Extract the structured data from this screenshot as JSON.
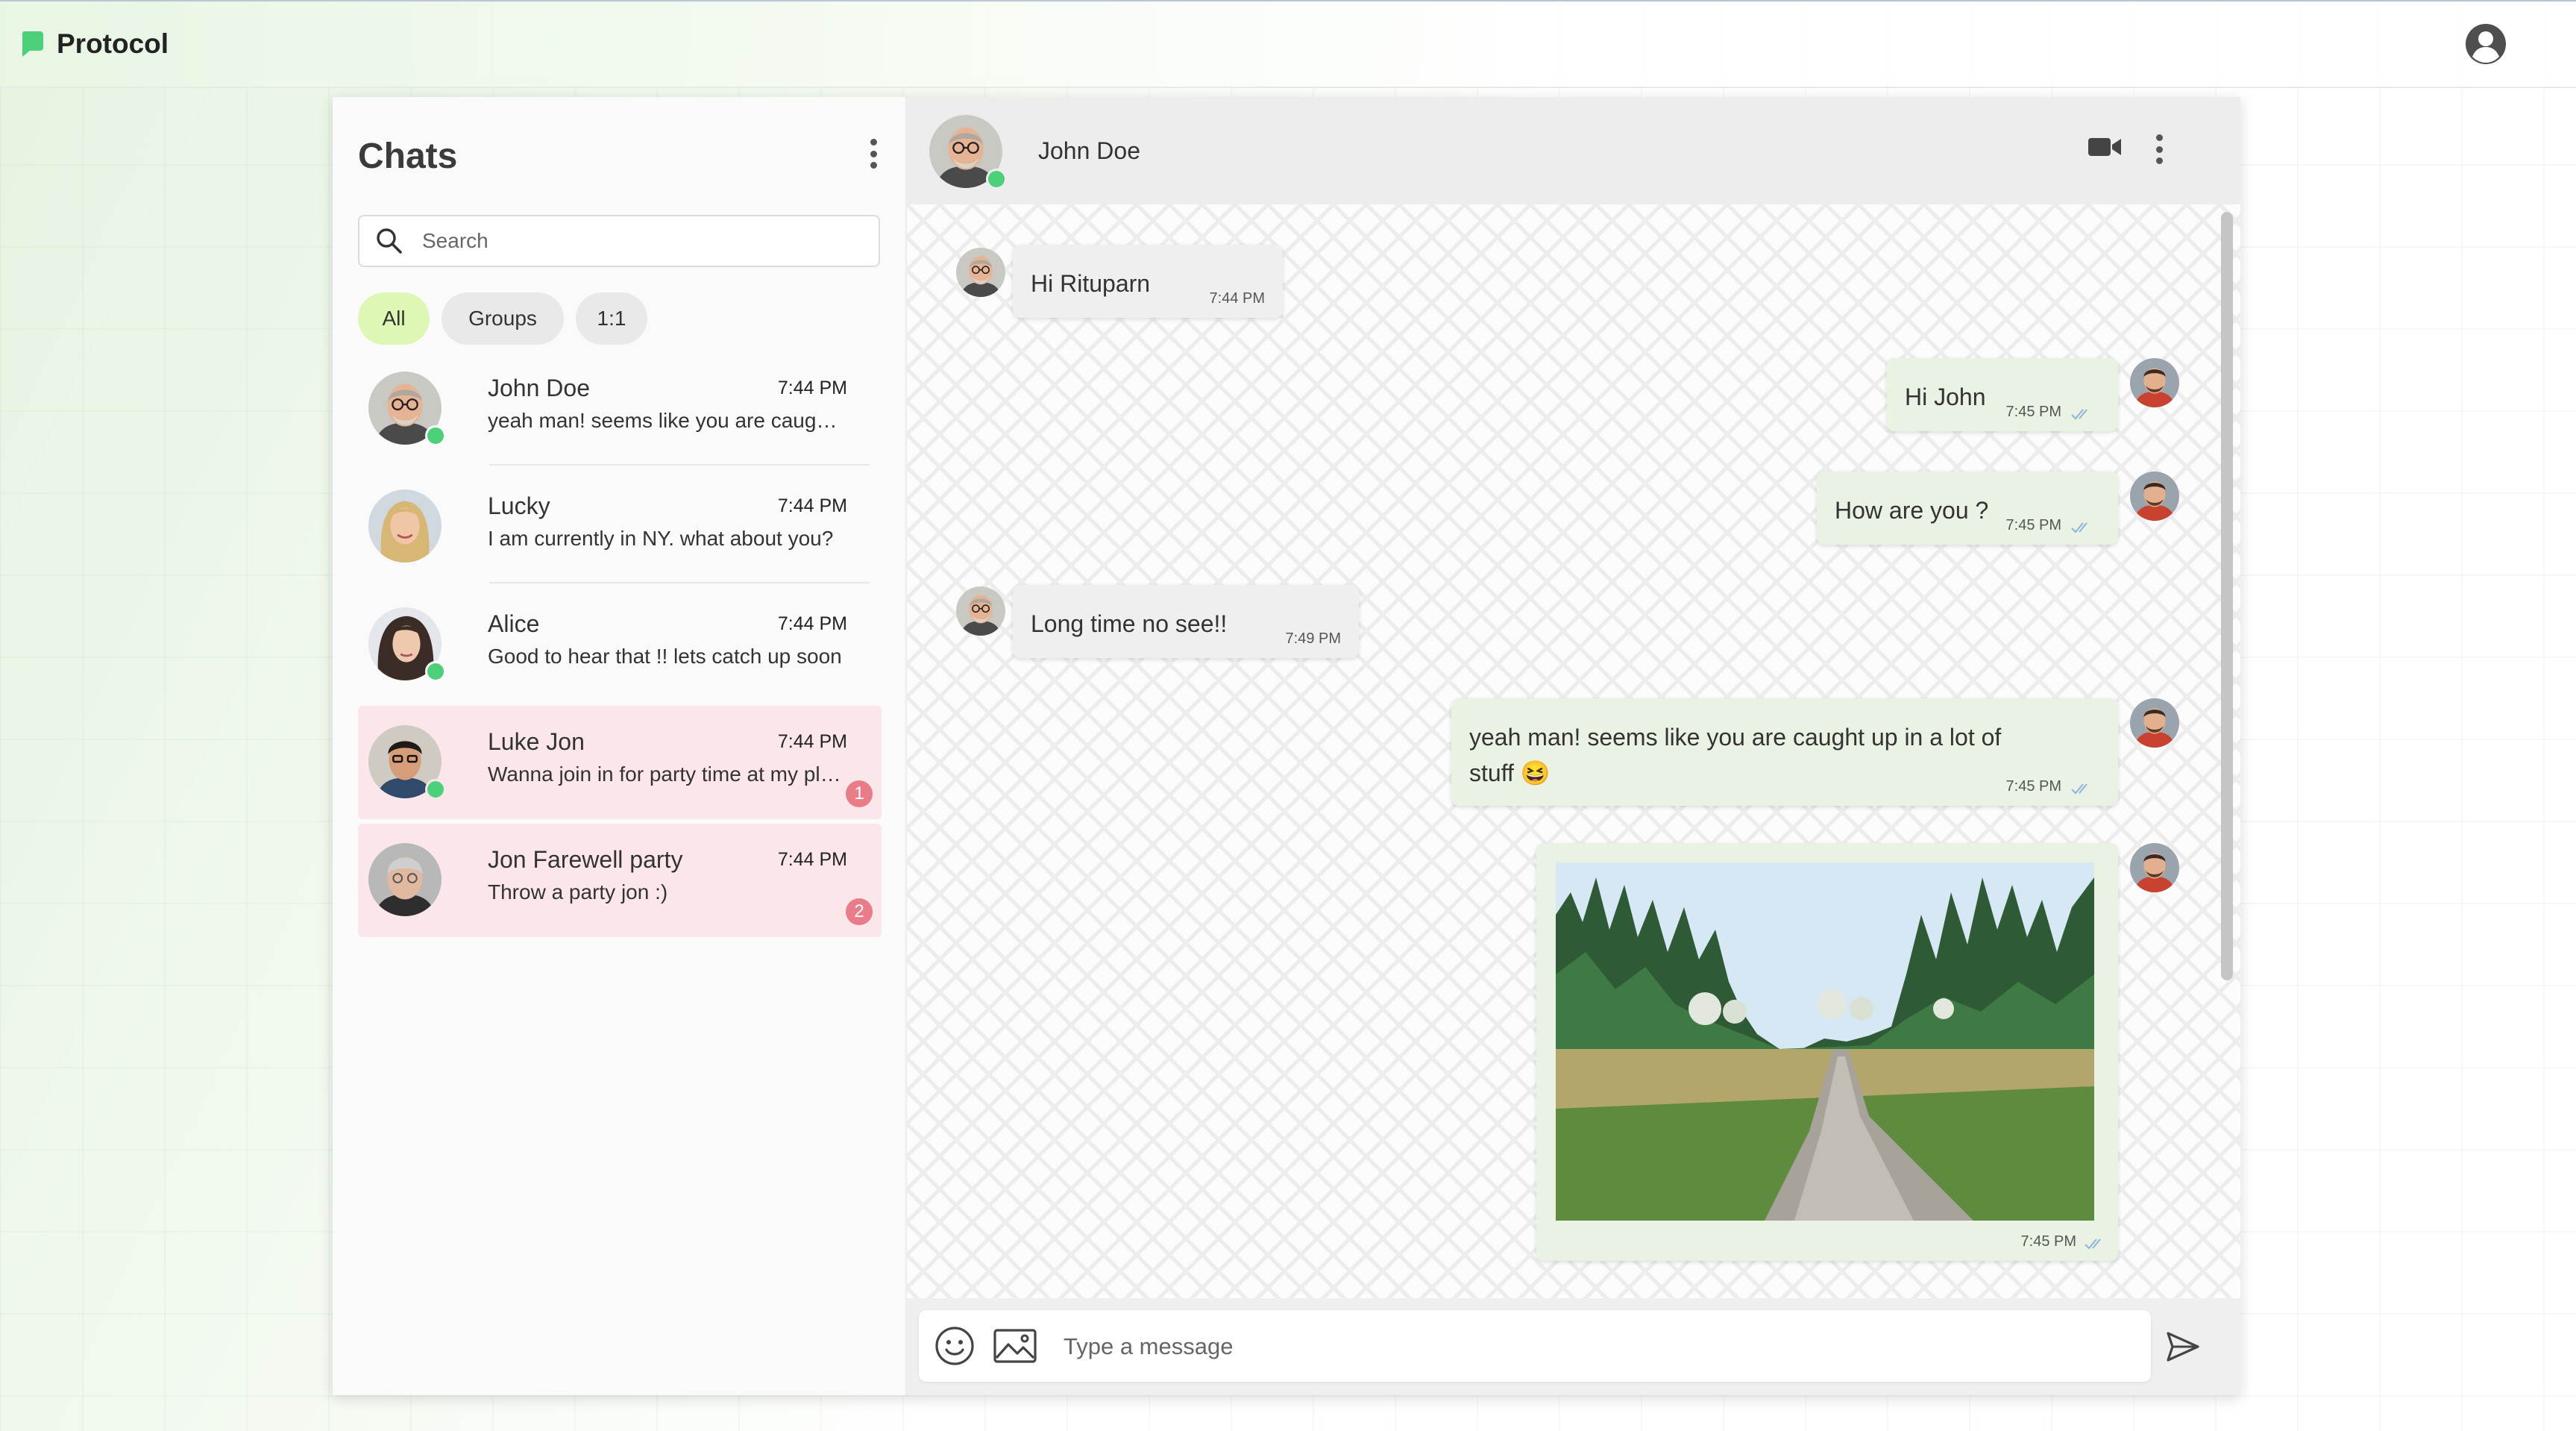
{
  "app": {
    "name": "Protocol",
    "brand_color": "#4cd079"
  },
  "account": {
    "icon": "account-circle-icon"
  },
  "sidebar": {
    "title": "Chats",
    "search_placeholder": "Search",
    "filters": [
      "All",
      "Groups",
      "1:1"
    ],
    "active_filter": "All",
    "chats": [
      {
        "name": "John Doe",
        "time": "7:44 PM",
        "preview": "yeah man! seems like you are caught up in a lot of stuff",
        "online": true,
        "unread": ""
      },
      {
        "name": "Lucky",
        "time": "7:44 PM",
        "preview": "I am currently in NY. what about you?",
        "online": false,
        "unread": ""
      },
      {
        "name": "Alice",
        "time": "7:44 PM",
        "preview": "Good to hear that !! lets catch up soon",
        "online": true,
        "unread": ""
      },
      {
        "name": "Luke Jon",
        "time": "7:44 PM",
        "preview": "Wanna join in for party time at my place",
        "online": true,
        "unread": "1"
      },
      {
        "name": "Jon Farewell party",
        "time": "7:44 PM",
        "preview": "Throw a party jon :)",
        "online": false,
        "unread": "2"
      }
    ]
  },
  "conversation": {
    "contact_name": "John Doe",
    "contact_online": true,
    "messages": [
      {
        "direction": "in",
        "text": "Hi Rituparn",
        "time": "7:44 PM"
      },
      {
        "direction": "out",
        "text": "Hi John",
        "time": "7:45 PM",
        "read": true
      },
      {
        "direction": "out",
        "text": "How are you ?",
        "time": "7:45 PM",
        "read": true
      },
      {
        "direction": "in",
        "text": "Long time no see!!",
        "time": "7:49 PM"
      },
      {
        "direction": "out",
        "text": "yeah man! seems like you are caught up in a lot of stuff 😆",
        "time": "7:45 PM",
        "read": true
      },
      {
        "direction": "out",
        "type": "image",
        "time": "7:45 PM",
        "read": true
      }
    ],
    "composer_placeholder": "Type a message",
    "read_tick_color": "#8ab4dd"
  }
}
